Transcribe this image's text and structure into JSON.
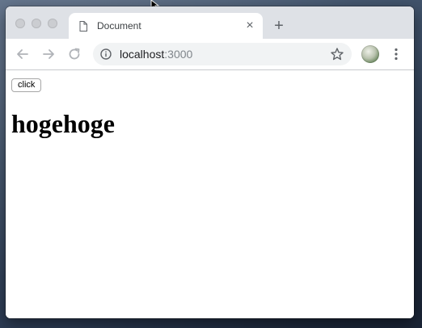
{
  "browser": {
    "tab": {
      "title": "Document",
      "close_glyph": "×",
      "icon": "page-icon"
    },
    "new_tab_glyph": "+",
    "omnibox": {
      "host": "localhost",
      "port": ":3000",
      "icon": "info-icon"
    }
  },
  "page": {
    "button_label": "click",
    "heading": "hogehoge"
  },
  "colors": {
    "titlebar": "#dee1e6",
    "omnibox_bg": "#f1f3f4",
    "icon_gray": "#5f6368"
  }
}
